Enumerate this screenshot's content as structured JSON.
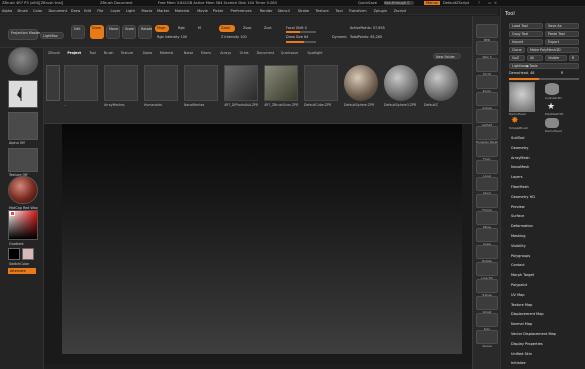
{
  "titlebar": {
    "left": "ZBrush 4R7 P3 (x64)[ZBrush trial]",
    "doc": "ZBrush Document",
    "stats": "Free Mem 3.841GB  Active Mem 584  Scratch Disk 144  Timer 0.083",
    "quicksave": "QuickSave",
    "seethrough": "See-through 0",
    "menus_btn": "Menus",
    "script": "DefaultZScript"
  },
  "menubar": {
    "items": [
      "Alpha",
      "Brush",
      "Color",
      "Document",
      "Draw",
      "Edit",
      "File",
      "Layer",
      "Light",
      "Macro",
      "Marker",
      "Material",
      "Movie",
      "Picker",
      "Preferences",
      "Render",
      "Stencil",
      "Stroke",
      "Texture",
      "Tool",
      "Transform",
      "Zplugin",
      "Zscript"
    ]
  },
  "shelf": {
    "projection_master": "Projection Master",
    "lightbox": "LightBox",
    "edit": "Edit",
    "draw": "Draw",
    "move": "Move",
    "scale": "Scale",
    "rotate": "Rotate",
    "mrgb": "Mrgb",
    "rgb": "Rgb",
    "m": "M",
    "rgb_intensity": "Rgb Intensity 100",
    "zadd": "Zadd",
    "zsub": "Zsub",
    "zcut": "Zcut",
    "z_intensity": "Z Intensity 100",
    "focal_shift": "Focal Shift 0",
    "draw_size": "Draw Size 64",
    "dynamic": "Dynamic",
    "active_points": "ActivePoints: 57,895",
    "total_points": "TotalPoints: 65,265"
  },
  "leftpanel": {
    "alpha_label": "Alpha Off",
    "texture_label": "Texture Off",
    "material_label": "MatCap Red Wax",
    "gradient_label": "Gradient",
    "switchcolor_label": "SwitchColor",
    "alternate_label": "Alternate"
  },
  "lightbox": {
    "tabs": [
      "ZBrush",
      "Project",
      "Tool",
      "Brush",
      "Texture",
      "Alpha",
      "Material",
      "Noise",
      "Fibers",
      "Arrays",
      "Grids",
      "Document",
      "Quicksave",
      "Spotlight"
    ],
    "active_tab": "Project",
    "new_folder": "New Folder",
    "items": [
      {
        "label": ".."
      },
      {
        "label": "ArrayMeshes"
      },
      {
        "label": "Humanoids"
      },
      {
        "label": "NanoMeshes"
      },
      {
        "label": "4R7_DiPlantsAsA.ZPR"
      },
      {
        "label": "4R7_ZBrushScan.ZPR"
      },
      {
        "label": "DefaultCube.ZPR"
      },
      {
        "label": "DefaultSphere.ZPR"
      },
      {
        "label": "DefaultSphere3.ZPR"
      },
      {
        "label": "DefaultZ"
      }
    ]
  },
  "rightstrip": {
    "buttons": [
      "BPR",
      "SPix 3",
      "Scroll",
      "Zoom",
      "Actual",
      "AAHalf",
      "Dynamic Persp",
      "Floor",
      "Local",
      "LSym",
      "Frame",
      "Move",
      "Scale",
      "Rotate",
      "Line Fill",
      "Transp",
      "Ghost",
      "Solo",
      "Xpose"
    ]
  },
  "toolpanel": {
    "title": "Tool",
    "load_tool": "Load Tool",
    "save_as": "Save As",
    "copy_tool": "Copy Tool",
    "paste_tool": "Paste Tool",
    "import": "Import",
    "export": "Export",
    "clone": "Clone",
    "make_polymesh": "Make PolyMesh3D",
    "goz": "GoZ",
    "all": "All",
    "visible": "Visible",
    "r": "R",
    "lightbox_tools": "Lightbox▶Tools",
    "current_tool": "DemoHead. 48",
    "r_label": "R",
    "thumbs": [
      {
        "label": "DemoHead"
      },
      {
        "label": "Cylinder3D"
      },
      {
        "label": "PolyMesh3D"
      },
      {
        "label": "SimpleBrush"
      },
      {
        "label": "DemoHead"
      }
    ],
    "items": [
      "SubTool",
      "Geometry",
      "ArrayMesh",
      "NanoMesh",
      "Layers",
      "FiberMesh",
      "Geometry HD",
      "Preview",
      "Surface",
      "Deformation",
      "Masking",
      "Visibility",
      "Polygroups",
      "Contact",
      "Morph Target",
      "Polypaint",
      "UV Map",
      "Texture Map",
      "Displacement Map",
      "Normal Map",
      "Vector Displacement Map",
      "Display Properties",
      "Unified Skin",
      "Initialize"
    ]
  },
  "colors": {
    "accent": "#e87a17",
    "background": "#1e1e1e",
    "picker_main": "#d43d3d"
  }
}
